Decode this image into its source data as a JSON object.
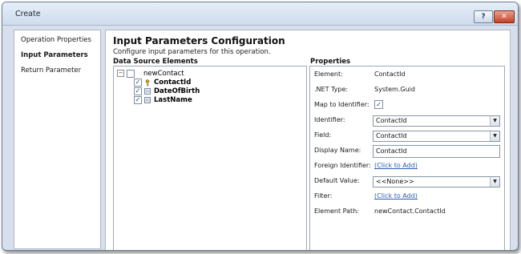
{
  "window": {
    "title": "Create",
    "help_label": "?",
    "close_label": "✕"
  },
  "sidebar": {
    "items": [
      {
        "label": "Operation Properties",
        "active": false
      },
      {
        "label": "Input Parameters",
        "active": true
      },
      {
        "label": "Return Parameter",
        "active": false
      }
    ]
  },
  "main": {
    "title": "Input Parameters Configuration",
    "description": "Configure input parameters for this operation.",
    "tree_header": "Data Source Elements",
    "props_header": "Properties"
  },
  "tree": {
    "expander": "−",
    "root": {
      "label": "newContact",
      "checked": false
    },
    "children": [
      {
        "label": "ContactId",
        "checked": true,
        "icon": "key-icon"
      },
      {
        "label": "DateOfBirth",
        "checked": true,
        "icon": "field-icon"
      },
      {
        "label": "LastName",
        "checked": true,
        "icon": "field-icon"
      }
    ],
    "check_mark": "✓"
  },
  "properties": {
    "element_label": "Element:",
    "element_value": "ContactId",
    "net_type_label": ".NET Type:",
    "net_type_value": "System.Guid",
    "map_label": "Map to Identifier:",
    "map_checked": "✓",
    "identifier_label": "Identifier:",
    "identifier_value": "ContactId",
    "field_label": "Field:",
    "field_value": "ContactId",
    "display_name_label": "Display Name:",
    "display_name_value": "ContactId",
    "foreign_identifier_label": "Foreign Identifier:",
    "foreign_identifier_link": "(Click to Add)",
    "default_value_label": "Default Value:",
    "default_value_value": "<<None>>",
    "filter_label": "Filter:",
    "filter_link": "(Click to Add)",
    "element_path_label": "Element Path:",
    "element_path_value": "newContact.ContactId",
    "dropdown_arrow": "▼"
  }
}
